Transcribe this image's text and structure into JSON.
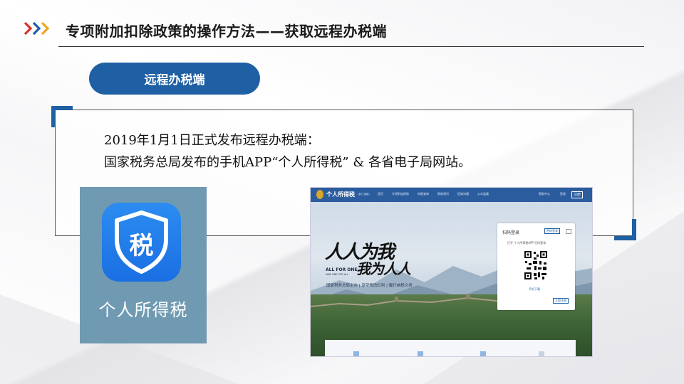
{
  "header": {
    "title": "专项附加扣除政策的操作方法——获取远程办税端"
  },
  "section": {
    "pill_label": "远程办税端"
  },
  "content": {
    "line1": "2019年1月1日正式发布远程办税端：",
    "line2": "国家税务总局发布的手机APP“个人所得税” & 各省电子局网站。"
  },
  "app": {
    "icon_char": "税",
    "label": "个人所得税"
  },
  "website": {
    "brand": "个人所得税",
    "brand_sub": "(浙江省版)",
    "nav": [
      "首页",
      "专项附加扣除",
      "申报查询",
      "税收常识",
      "征纳沟通",
      "公众监督"
    ],
    "nav_right": [
      "帮助中心",
      "登录",
      "注册"
    ],
    "calligraphy_1": "人人为我",
    "calligraphy_2": "我为人人",
    "all_for_one": "ALL FOR ONE",
    "one_for_all": "AND ONE FOR ALL",
    "slogan": "国家税务总局主办 | 享受税改红利 | 履行纳税义务",
    "login_title": "扫码登录",
    "login_switch": "密码登录",
    "login_scan_hint": "打开 个人所得税APP 扫码登录",
    "login_download": "手机下载",
    "login_register": "立即注册"
  },
  "colors": {
    "accent": "#1f5fa3",
    "chevron_1": "#d9342b",
    "chevron_2": "#1f5fa3",
    "chevron_3": "#f2a51f"
  }
}
